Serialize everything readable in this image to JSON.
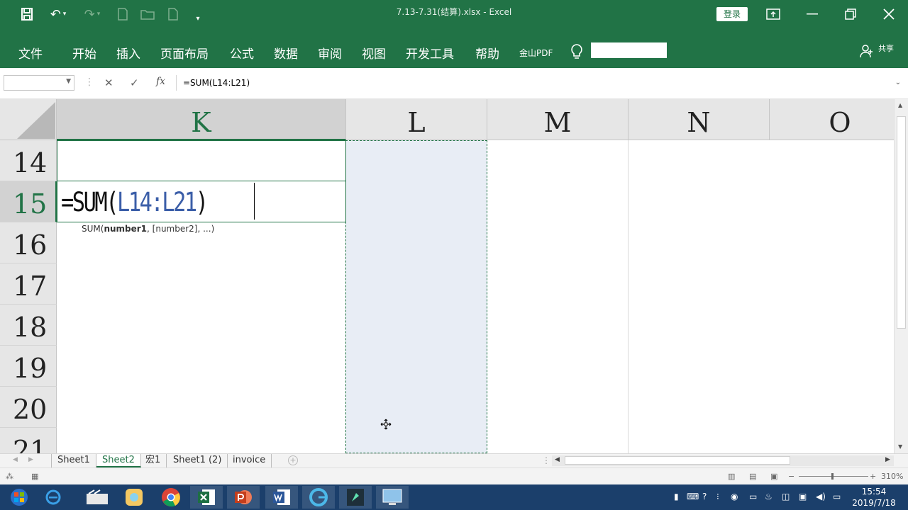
{
  "titlebar": {
    "title": "7.13-7.31(结算).xlsx  -  Excel",
    "login_label": "登录"
  },
  "ribbon": {
    "tabs": [
      "文件",
      "开始",
      "插入",
      "页面布局",
      "公式",
      "数据",
      "审阅",
      "视图",
      "开发工具",
      "帮助",
      "金山PDF"
    ],
    "share_label": "共享"
  },
  "formula_bar": {
    "name_box_value": "",
    "formula": "=SUM(L14:L21)"
  },
  "sheet": {
    "columns": [
      "K",
      "L",
      "M",
      "N",
      "O"
    ],
    "rows": [
      "14",
      "15",
      "16",
      "17",
      "18",
      "19",
      "20",
      "21"
    ],
    "active_cell_text": {
      "prefix": "=SUM(",
      "ref": "L14:L21",
      "suffix": ")"
    },
    "tooltip": {
      "fn": "SUM(",
      "arg1": "number1",
      "rest": ", [number2], ...)"
    }
  },
  "sheet_tabs": [
    "Sheet1",
    "Sheet2",
    "宏1",
    "Sheet1 (2)",
    "invoice"
  ],
  "active_sheet_index": 1,
  "statusbar": {
    "zoom": "310%"
  },
  "taskbar": {
    "apps": [
      "start",
      "ie",
      "file-manager",
      "finder-like",
      "chrome",
      "excel",
      "powerpoint",
      "word",
      "browser",
      "filmora",
      "remote-desktop"
    ],
    "time": "15:54",
    "date": "2019/7/18"
  },
  "colors": {
    "excel_green": "#217346",
    "range_ref_blue": "#3b5ea8",
    "taskbar_blue": "#1b3f6b"
  }
}
